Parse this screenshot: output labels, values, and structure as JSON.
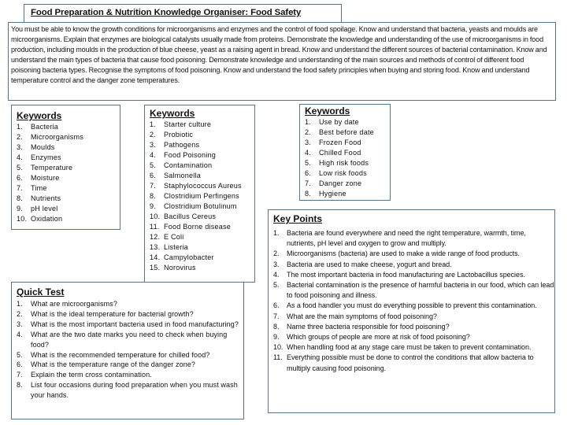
{
  "title": "Food Preparation & Nutrition Knowledge Organiser: Food Safety",
  "intro": "You must be able to know the growth conditions for microorganisms and enzymes and the control of food spoilage.  Know and understand that bacteria, yeasts and moulds are microorganisms.  Explain that enzymes are biological catalysts usually made from proteins.  Demonstrate the knowledge and understanding of the use of microorganisms in food production, including moulds in the production of blue cheese, yeast as a raising agent in bread.  Know and understand the different sources of bacterial contamination.  Know and understand the main types of bacteria that cause food poisoning.  Demonstrate knowledge and understanding of the main sources and methods of control of different food poisoning bacteria types.  Recognise the symptoms of food poisoning.  Know and understand the food safety principles when buying and storing food.  Know and understand temperature control and the danger zone temperatures.",
  "keywords1": {
    "heading": "Keywords",
    "items": [
      "Bacteria",
      "Microorganisms",
      "Moulds",
      "Enzymes",
      "Temperature",
      "Moisture",
      "Time",
      "Nutrients",
      "pH level",
      "Oxidation"
    ]
  },
  "keywords2": {
    "heading": "Keywords",
    "items": [
      "Starter culture",
      "Probiotic",
      "Pathogens",
      "Food Poisoning",
      "Contamination",
      "Salmonella",
      "Staphylococcus Aureus",
      "Clostridium Perfingens",
      "Clostridium Botulinum",
      "Bacillus Cereus",
      "Food Borne disease",
      "E Coli",
      "Listeria",
      "Campylobacter",
      "Norovirus"
    ]
  },
  "keywords3": {
    "heading": "Keywords",
    "items": [
      "Use by date",
      "Best before date",
      "Frozen Food",
      "Chilled Food",
      "High risk foods",
      "Low risk foods",
      "Danger zone",
      "Hygiene"
    ]
  },
  "quick_test": {
    "heading": "Quick Test",
    "items": [
      "What are microorganisms?",
      "What is the ideal temperature for bacterial growth?",
      "What is the most important bacteria used in food manufacturing?",
      "What are the two date marks you need to check when buying food?",
      "What is the recommended temperature for chilled food?",
      "What is the temperature range of the danger zone?",
      "Explain the term cross contamination.",
      "List four occasions during food preparation when you must wash your hands."
    ]
  },
  "key_points": {
    "heading": "Key Points",
    "items": [
      "Bacteria are found everywhere and need the right temperature, warmth, time, nutrients, pH level and oxygen to grow and multiply.",
      "Microorganisms (bacteria) are used to make a wide range of food products.",
      "Bacteria are used to make cheese, yogurt and bread.",
      "The most important bacteria in food manufacturing are Lactobacillus species.",
      "Bacterial contamination is the presence of harmful bacteria in our food, which can lead to food poisoning and illness.",
      "As a food handler you must do everything possible to prevent this contamination.",
      "What are the main symptoms of food poisoning?",
      "Name three bacteria responsible for food poisoning?",
      "Which groups of people are more at risk of food poisoning?",
      "When handling food at any stage care must be taken to prevent contamination.",
      "Everything possible must be done to control the conditions that allow bacteria to multiply causing food poisoning."
    ]
  }
}
